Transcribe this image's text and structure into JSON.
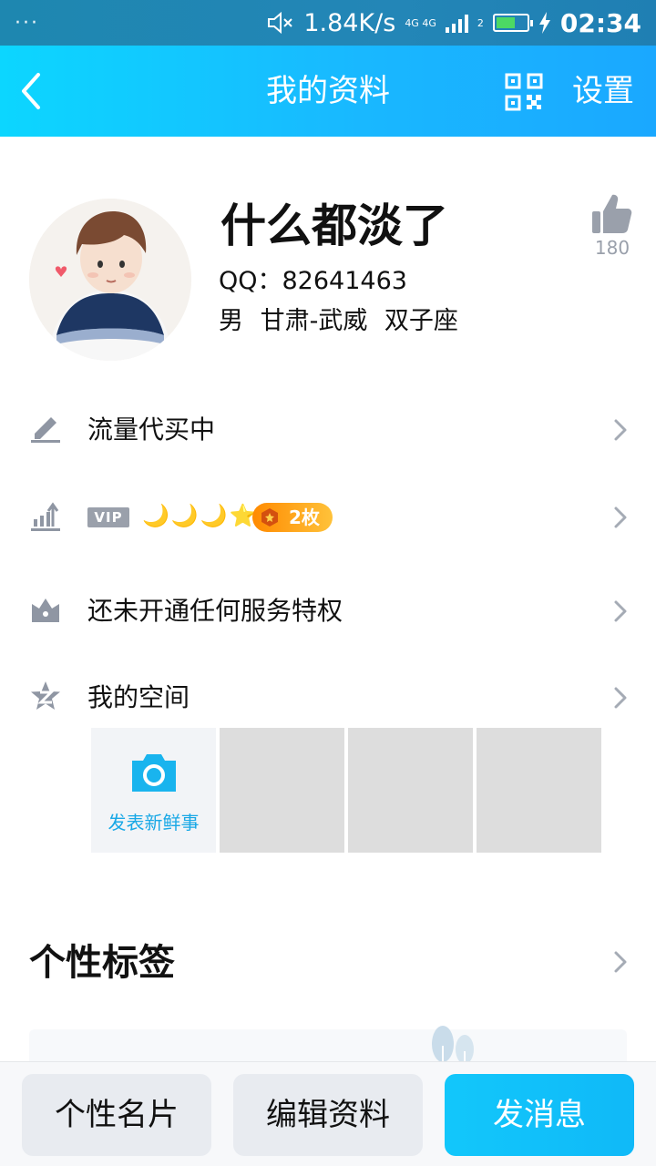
{
  "status_bar": {
    "dots": "···",
    "speed": "1.84K/s",
    "network": "4G 4G",
    "sim": "2",
    "time": "02:34",
    "battery_level": 0.55
  },
  "header": {
    "title": "我的资料",
    "settings_label": "设置"
  },
  "profile": {
    "nickname": "什么都淡了",
    "qq": "QQ：82641463",
    "meta": "男 甘肃-武威 双子座",
    "likes": "180"
  },
  "rows": {
    "signature": "流量代买中",
    "vip_badge": "VIP",
    "levels": [
      "🌙",
      "🌙",
      "🌙",
      "⭐"
    ],
    "medal_count": "2枚",
    "privilege": "还未开通任何服务特权",
    "qzone": "我的空间"
  },
  "qzone": {
    "post_label": "发表新鲜事"
  },
  "tags": {
    "title": "个性标签"
  },
  "bottom_bar": {
    "card": "个性名片",
    "edit": "编辑资料",
    "message": "发消息"
  },
  "colors": {
    "header_start": "#0cd6ff",
    "header_end": "#1aa8ff",
    "icon_gray": "#9aa0ab",
    "accent_blue": "#19a8e6"
  }
}
